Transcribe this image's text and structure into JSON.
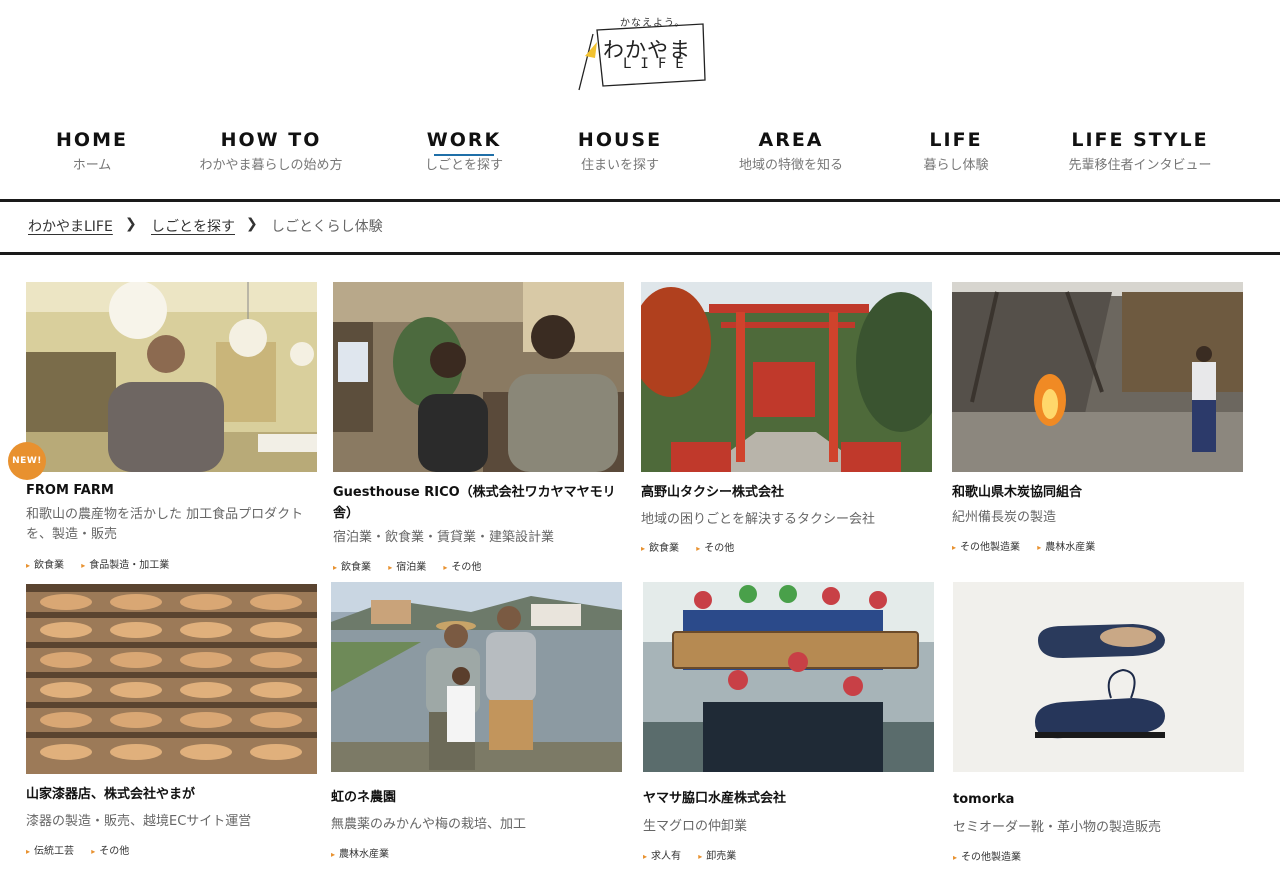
{
  "logo": {
    "tagline": "かなえよう。",
    "main": "わかやま",
    "sub": "LIFE"
  },
  "nav": [
    {
      "en": "HOME",
      "jp": "ホーム",
      "active": false
    },
    {
      "en": "HOW TO",
      "jp": "わかやま暮らしの始め方",
      "active": false
    },
    {
      "en": "WORK",
      "jp": "しごとを探す",
      "active": true
    },
    {
      "en": "HOUSE",
      "jp": "住まいを探す",
      "active": false
    },
    {
      "en": "AREA",
      "jp": "地域の特徴を知る",
      "active": false
    },
    {
      "en": "LIFE",
      "jp": "暮らし体験",
      "active": false
    },
    {
      "en": "LIFE STYLE",
      "jp": "先輩移住者インタビュー",
      "active": false
    }
  ],
  "breadcrumb": {
    "home": "わかやまLIFE",
    "parent": "しごとを探す",
    "current": "しごとくらし体験"
  },
  "badge_new": "NEW!",
  "cards": [
    {
      "title": "FROM FARM",
      "desc": "和歌山の農産物を活かした 加工食品プロダクトを、製造・販売",
      "tags": [
        "飲食業",
        "食品製造・加工業"
      ]
    },
    {
      "title": "Guesthouse RICO（株式会社ワカヤマヤモリ舎）",
      "desc": "宿泊業・飲食業・賃貸業・建築設計業",
      "tags": [
        "飲食業",
        "宿泊業",
        "その他"
      ]
    },
    {
      "title": "高野山タクシー株式会社",
      "desc": "地域の困りごとを解決するタクシー会社",
      "tags": [
        "飲食業",
        "その他"
      ]
    },
    {
      "title": "和歌山県木炭協同組合",
      "desc": "紀州備長炭の製造",
      "tags": [
        "その他製造業",
        "農林水産業"
      ]
    },
    {
      "title": "山家漆器店、株式会社やまが",
      "desc": "漆器の製造・販売、越境ECサイト運営",
      "tags": [
        "伝統工芸",
        "その他"
      ]
    },
    {
      "title": "虹のネ農園",
      "desc": "無農薬のみかんや梅の栽培、加工",
      "tags": [
        "農林水産業"
      ]
    },
    {
      "title": "ヤマサ脇口水産株式会社",
      "desc": "生マグロの仲卸業",
      "tags": [
        "求人有",
        "卸売業"
      ]
    },
    {
      "title": "tomorka",
      "desc": "セミオーダー靴・革小物の製造販売",
      "tags": [
        "その他製造業"
      ]
    }
  ],
  "colors": {
    "accent": "#e8912f",
    "active_underline": "#1f6fa8",
    "rule": "#1a1a1a"
  }
}
